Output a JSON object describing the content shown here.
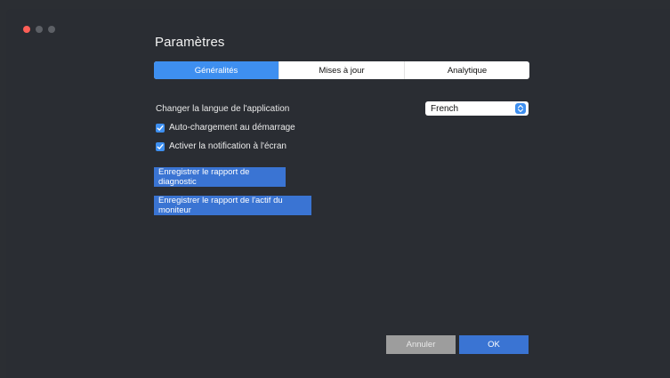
{
  "window": {
    "title": "Paramètres"
  },
  "tabs": [
    {
      "label": "Généralités",
      "active": true
    },
    {
      "label": "Mises à jour",
      "active": false
    },
    {
      "label": "Analytique",
      "active": false
    }
  ],
  "language": {
    "label": "Changer la langue de l'application",
    "selected": "French"
  },
  "checkboxes": [
    {
      "label": "Auto-chargement au démarrage",
      "checked": true
    },
    {
      "label": "Activer la notification à l'écran",
      "checked": true
    }
  ],
  "buttons": {
    "diagnostic": "Enregistrer le rapport de diagnostic",
    "asset_report": "Enregistrer le rapport de l'actif du moniteur",
    "cancel": "Annuler",
    "ok": "OK"
  },
  "colors": {
    "accent": "#3e8ff0",
    "button": "#3a74d3",
    "background": "#2a2d33",
    "close": "#fe5f57"
  }
}
